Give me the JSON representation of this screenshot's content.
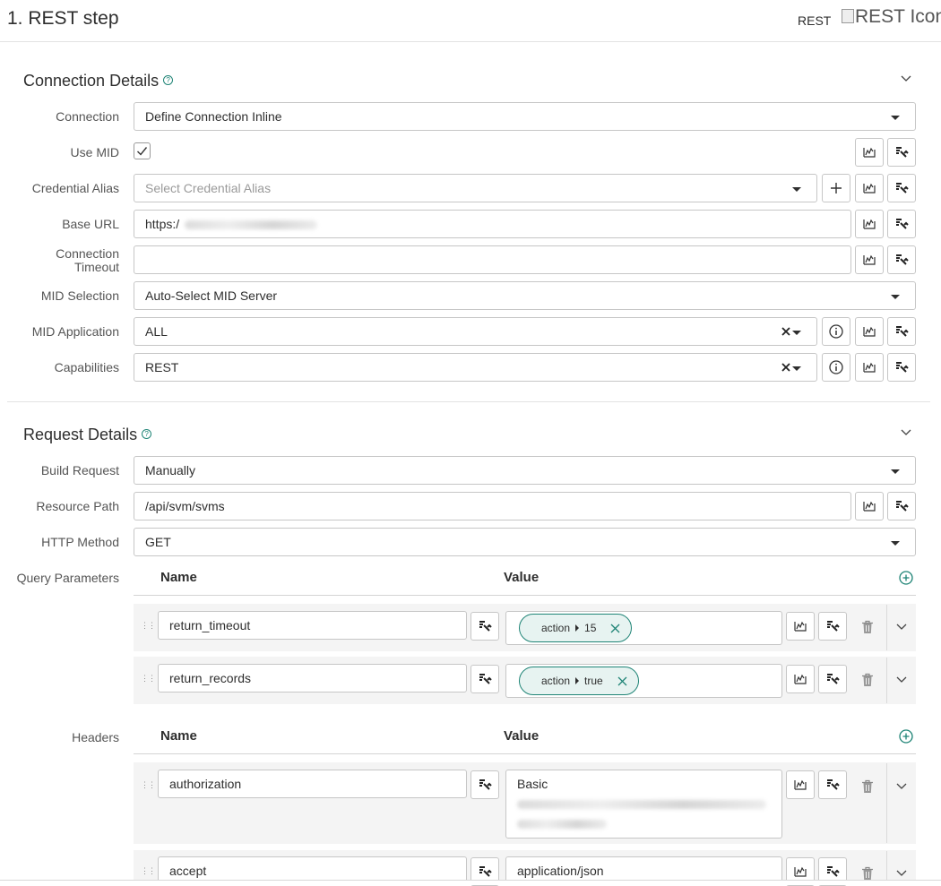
{
  "header": {
    "title": "1.  REST step",
    "type_label": "REST",
    "icon_alt": "REST Icon"
  },
  "connection_section": {
    "title": "Connection Details",
    "fields": {
      "connection": {
        "label": "Connection",
        "value": "Define Connection Inline"
      },
      "use_mid": {
        "label": "Use MID",
        "checked": true
      },
      "credential_alias": {
        "label": "Credential Alias",
        "placeholder": "Select Credential Alias"
      },
      "base_url": {
        "label": "Base URL",
        "value": "https:/"
      },
      "connection_timeout": {
        "label_line1": "Connection",
        "label_line2": "Timeout",
        "value": ""
      },
      "mid_selection": {
        "label": "MID Selection",
        "value": "Auto-Select MID Server"
      },
      "mid_application": {
        "label": "MID Application",
        "value": "ALL"
      },
      "capabilities": {
        "label": "Capabilities",
        "value": "REST"
      }
    }
  },
  "request_section": {
    "title": "Request Details",
    "fields": {
      "build_request": {
        "label": "Build Request",
        "value": "Manually"
      },
      "resource_path": {
        "label": "Resource Path",
        "value": "/api/svm/svms"
      },
      "http_method": {
        "label": "HTTP Method",
        "value": "GET"
      }
    },
    "query_parameters": {
      "label": "Query Parameters",
      "col_name": "Name",
      "col_value": "Value",
      "rows": [
        {
          "name": "return_timeout",
          "pill_source": "action",
          "pill_value": "15"
        },
        {
          "name": "return_records",
          "pill_source": "action",
          "pill_value": "true"
        }
      ]
    },
    "headers": {
      "label": "Headers",
      "col_name": "Name",
      "col_value": "Value",
      "rows": [
        {
          "name": "authorization",
          "value": "Basic"
        },
        {
          "name": "accept",
          "value": "application/json"
        }
      ]
    }
  },
  "icons": {
    "help": "help-circle-icon",
    "collapse": "chevron-down-icon",
    "data_pill": "data-pill-picker-icon",
    "script": "script-toggle-icon",
    "add": "plus-icon",
    "info": "info-icon",
    "clear": "clear-x-icon",
    "delete": "trash-icon",
    "drag": "drag-handle-icon",
    "add_row": "add-circle-icon"
  },
  "colors": {
    "accent": "#1f8476",
    "pill_bg": "#e7f3f1",
    "border": "#c6c6c6",
    "row_bg": "#f4f4f4"
  }
}
